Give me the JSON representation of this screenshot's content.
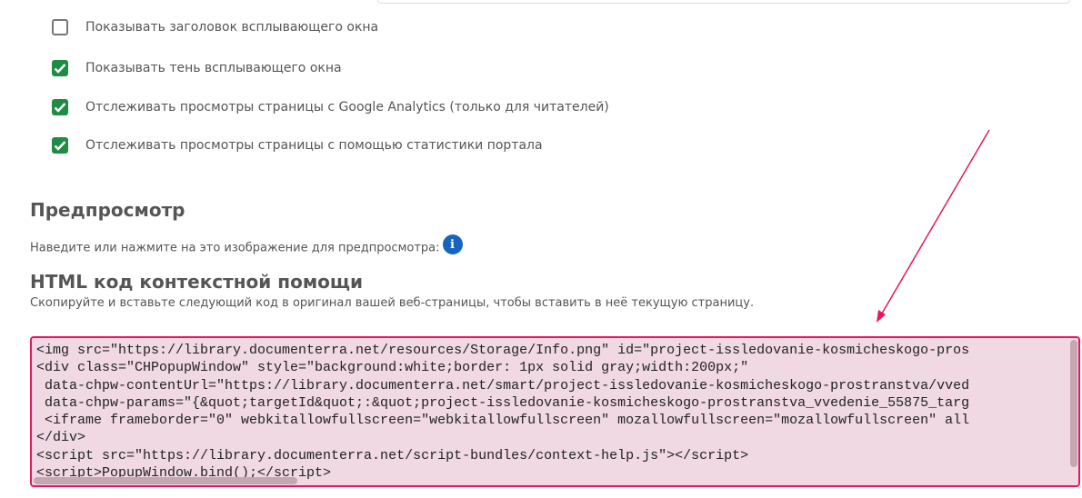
{
  "checkboxes": [
    {
      "label": "Показывать заголовок всплывающего окна",
      "checked": false
    },
    {
      "label": "Показывать тень всплывающего окна",
      "checked": true
    },
    {
      "label": "Отслеживать просмотры страницы с Google Analytics (только для читателей)",
      "checked": true
    },
    {
      "label": "Отслеживать просмотры страницы с помощью статистики портала",
      "checked": true
    }
  ],
  "preview": {
    "title": "Предпросмотр",
    "description": "Наведите или нажмите на это изображение для предпросмотра:",
    "icon": "info-icon"
  },
  "html_code": {
    "title": "HTML код контекстной помощи",
    "description": "Скопируйте и вставьте следующий код в оригинал вашей веб-страницы, чтобы вставить в неё текущую страницу.",
    "lines": [
      "<img src=\"https://library.documenterra.net/resources/Storage/Info.png\" id=\"project-issledovanie-kosmicheskogo-pros",
      "<div class=\"CHPopupWindow\" style=\"background:white;border: 1px solid gray;width:200px;\"",
      " data-chpw-contentUrl=\"https://library.documenterra.net/smart/project-issledovanie-kosmicheskogo-prostranstva/vved",
      " data-chpw-params=\"{&quot;targetId&quot;:&quot;project-issledovanie-kosmicheskogo-prostranstva_vvedenie_55875_targ",
      " <iframe frameborder=\"0\" webkitallowfullscreen=\"webkitallowfullscreen\" mozallowfullscreen=\"mozallowfullscreen\" all",
      "</div>",
      "<script src=\"https://library.documenterra.net/script-bundles/context-help.js\"></script>",
      "<script>PopupWindow.bind();</script>"
    ]
  },
  "colors": {
    "checkbox_checked": "#1e8c45",
    "highlight_border": "#e8175d",
    "highlight_bg": "#f0d9e2",
    "annotation_arrow": "#e8175d",
    "info_icon": "#1565c0"
  }
}
